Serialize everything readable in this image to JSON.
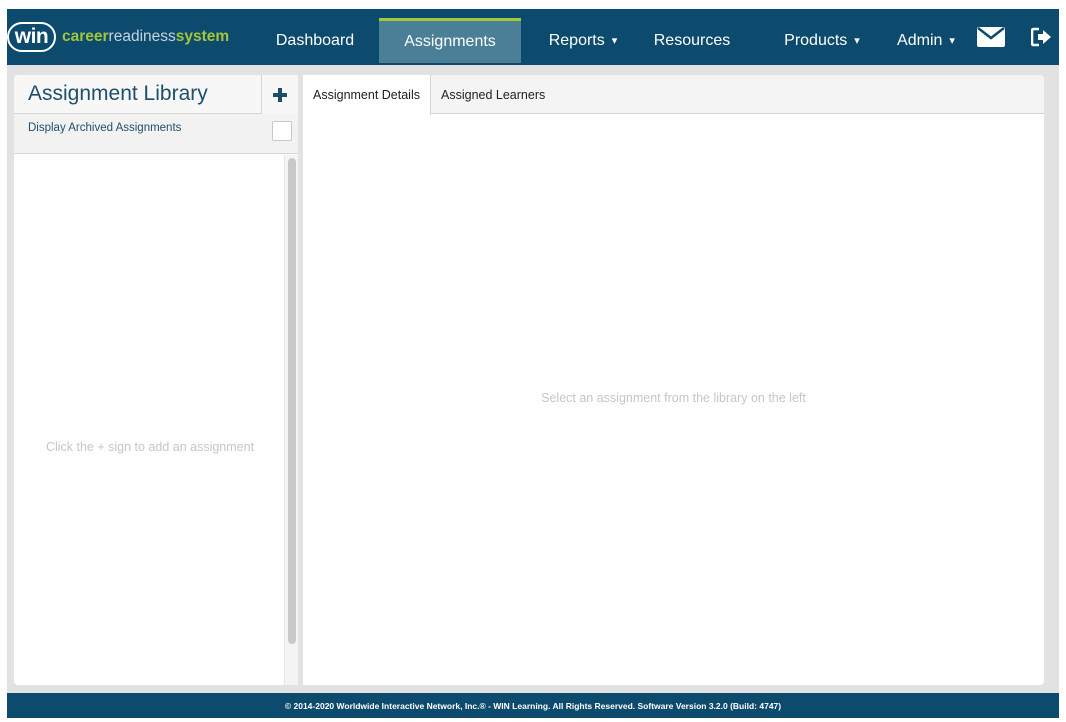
{
  "app": {
    "logo_badge": "win",
    "logo_text_career": "career",
    "logo_text_readiness": "readiness",
    "logo_text_system": "system"
  },
  "nav": {
    "dashboard": "Dashboard",
    "assignments": "Assignments",
    "reports": "Reports",
    "resources": "Resources",
    "products": "Products",
    "admin": "Admin",
    "caret": "▾",
    "active_item": "Assignments",
    "icons": [
      "envelope-icon",
      "logout-icon"
    ]
  },
  "library": {
    "title": "Assignment Library",
    "add_icon": "plus-icon",
    "archived_label": "Display Archived Assignments",
    "archived_checked": false,
    "empty_message": "Click the + sign to add an assignment"
  },
  "details": {
    "tabs": [
      {
        "label": "Assignment Details",
        "active": true
      },
      {
        "label": "Assigned Learners",
        "active": false
      }
    ],
    "empty_message": "Select an assignment from the library on the left"
  },
  "footer": {
    "text": "© 2014-2020 Worldwide Interactive Network, Inc.® - WIN Learning. All Rights Reserved. Software Version 3.2.0 (Build: 4747)"
  },
  "colors": {
    "nav_bg": "#0c4a6e",
    "nav_active_bg": "#4a7f97",
    "accent_green": "#a4c639",
    "title_blue": "#1f4e6a"
  }
}
